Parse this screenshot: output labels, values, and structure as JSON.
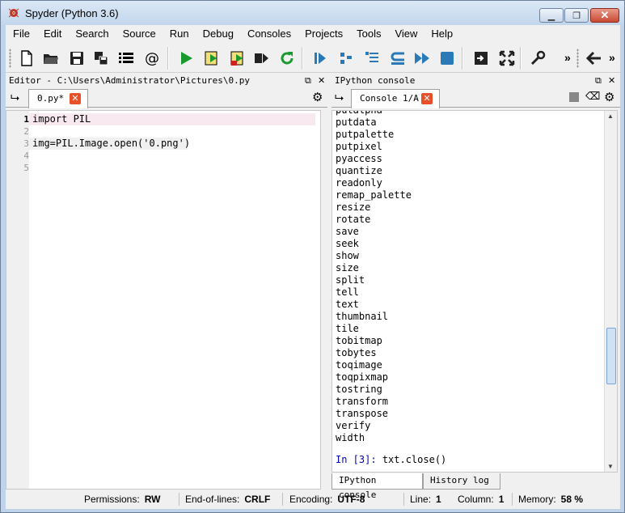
{
  "window": {
    "title": "Spyder (Python 3.6)",
    "controls": {
      "minimize": "▁",
      "maximize": "❐",
      "close": "✕"
    }
  },
  "menu": [
    "File",
    "Edit",
    "Search",
    "Source",
    "Run",
    "Debug",
    "Consoles",
    "Projects",
    "Tools",
    "View",
    "Help"
  ],
  "toolbar": {
    "icons": [
      "new-file-icon",
      "open-folder-icon",
      "save-icon",
      "save-all-icon",
      "list-icon",
      "at-icon",
      "run-icon",
      "run-cell-icon",
      "run-cell-advance-icon",
      "run-selection-icon",
      "rerun-icon",
      "debug-icon",
      "step-icon",
      "step-into-icon",
      "step-return-icon",
      "continue-icon",
      "stop-icon",
      "maximize-pane-icon",
      "fullscreen-icon",
      "preferences-icon",
      "back-arrow-icon"
    ],
    "more": "»"
  },
  "editor": {
    "title": "Editor - C:\\Users\\Administrator\\Pictures\\0.py",
    "tab_label": "0.py*",
    "line_numbers": [
      "1",
      "2",
      "3",
      "4",
      "5"
    ],
    "lines": [
      "import PIL",
      "",
      "img=PIL.Image.open('0.png')",
      "",
      ""
    ]
  },
  "console": {
    "title": "IPython console",
    "tab_label": "Console 1/A",
    "output": [
      "putdata",
      "putpalette",
      "putpixel",
      "pyaccess",
      "quantize",
      "readonly",
      "remap_palette",
      "resize",
      "rotate",
      "save",
      "seek",
      "show",
      "size",
      "split",
      "tell",
      "text",
      "thumbnail",
      "tile",
      "tobitmap",
      "tobytes",
      "toqimage",
      "toqpixmap",
      "tostring",
      "transform",
      "transpose",
      "verify",
      "width"
    ],
    "partial_top": "putalpha",
    "prompt": "In [3]:",
    "command": "txt.close()",
    "bottom_tabs": [
      "IPython console",
      "History log"
    ]
  },
  "status": {
    "permissions_label": "Permissions:",
    "permissions": "RW",
    "eol_label": "End-of-lines:",
    "eol": "CRLF",
    "encoding_label": "Encoding:",
    "encoding": "UTF-8",
    "line_label": "Line:",
    "line": "1",
    "column_label": "Column:",
    "column": "1",
    "memory_label": "Memory:",
    "memory": "58 %"
  }
}
